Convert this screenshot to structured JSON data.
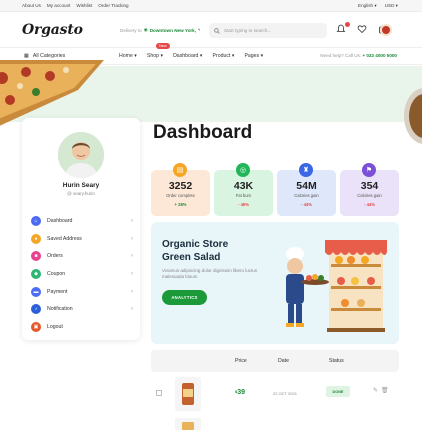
{
  "topbar": {
    "links": [
      "About Us",
      "My account",
      "Wishlist",
      "Order Tracking"
    ],
    "language": "English",
    "currency": "USD"
  },
  "header": {
    "logo": "Orgasto",
    "deliver_label": "Delivery to",
    "deliver_location": "Downtown New York,",
    "search_placeholder": "Start typing to search..."
  },
  "nav": {
    "categories": "All Categories",
    "menu": [
      "Home",
      "Shop",
      "Dashboard",
      "Product",
      "Pages"
    ],
    "new_badge": "New",
    "help_label": "Need help? Call Us:",
    "help_phone": "+ 032 4000 5000"
  },
  "page_title": "Dashboard",
  "profile": {
    "name": "Hurin Seary",
    "handle": "@ seary.hurin",
    "menu": [
      {
        "label": "Dashboard",
        "color": "#4b6bf5",
        "icon": "home-icon"
      },
      {
        "label": "Saved Address",
        "color": "#f5a623",
        "icon": "map-pin-icon"
      },
      {
        "label": "Orders",
        "color": "#e84393",
        "icon": "box-icon"
      },
      {
        "label": "Coupon",
        "color": "#2bb673",
        "icon": "ticket-icon"
      },
      {
        "label": "Payment",
        "color": "#4b6bf5",
        "icon": "card-icon"
      },
      {
        "label": "Notification",
        "color": "#2b5fd9",
        "icon": "bell-icon"
      },
      {
        "label": "Logout",
        "color": "#e8562a",
        "icon": "lock-icon"
      }
    ]
  },
  "stats": [
    {
      "value": "3252",
      "label": "Order complete",
      "change": "+ 28%",
      "bg": "#fde8d7",
      "icon_bg": "#f5a623",
      "change_color": "#1c8a3a"
    },
    {
      "value": "43K",
      "label": "Fat burn",
      "change": "- 45%",
      "bg": "#d9f5e1",
      "icon_bg": "#22b55a",
      "change_color": "#e54848"
    },
    {
      "value": "54M",
      "label": "Calories gain",
      "change": "- 44%",
      "bg": "#dfe8fb",
      "icon_bg": "#3a66e8",
      "change_color": "#e54848"
    },
    {
      "value": "354",
      "label": "Calories gain",
      "change": "- 44%",
      "bg": "#e9e2f8",
      "icon_bg": "#7b4fd6",
      "change_color": "#e54848"
    }
  ],
  "promo": {
    "heading": "Organic Store Green Salad",
    "description": "Vivamus adipiscing dolor dignissim libero luctus malesuada bluum",
    "button": "ANALYTICS"
  },
  "table": {
    "headers": [
      "Price",
      "Date",
      "Status"
    ],
    "rows": [
      {
        "price_currency": "$",
        "price": "39",
        "date": "22 OCT 2021",
        "status": "DONE"
      }
    ]
  },
  "colors": {
    "brand_green": "#1c9a3a",
    "banner": "#e9f5ea",
    "promo_bg": "#e8f5f9"
  }
}
